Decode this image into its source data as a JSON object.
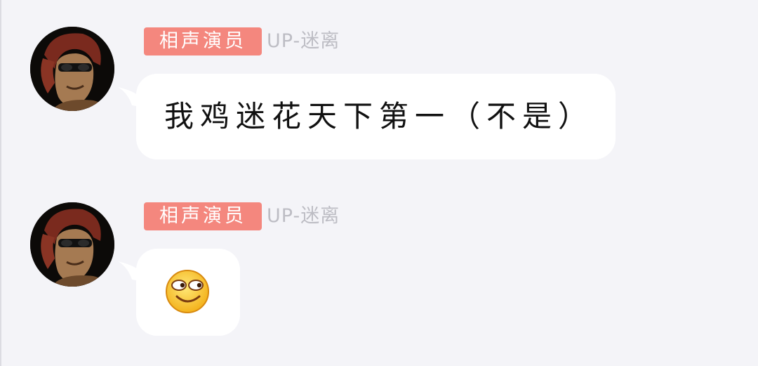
{
  "messages": [
    {
      "badge": "相声演员",
      "sender": "UP-迷离",
      "text": "我鸡迷花天下第一（不是）"
    },
    {
      "badge": "相声演员",
      "sender": "UP-迷离",
      "emoji": "smirk-face-emoji"
    }
  ],
  "colors": {
    "background": "#f4f4f8",
    "badge": "#f4877e",
    "sender": "#bdbdc4",
    "bubble": "#ffffff"
  }
}
